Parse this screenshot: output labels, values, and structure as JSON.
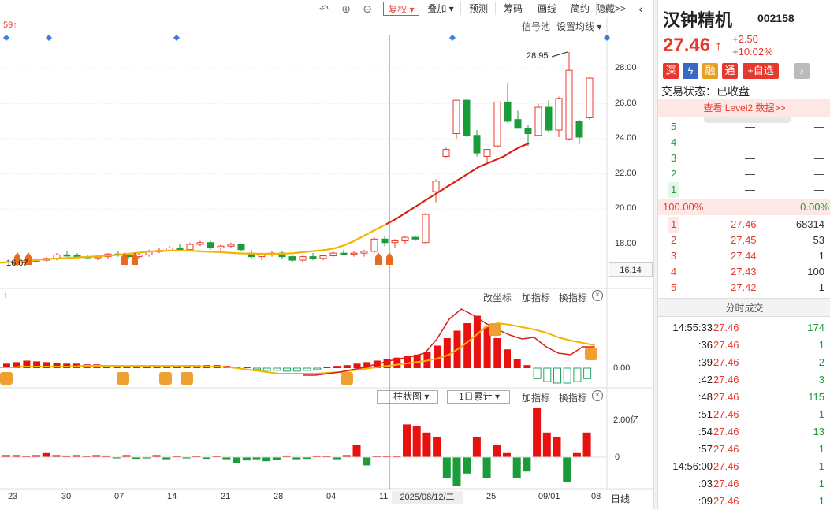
{
  "toolbar": {
    "undo_icon": "undo-icon",
    "zoom_in_icon": "zoom-in-icon",
    "zoom_out_icon": "zoom-out-icon",
    "fuquan": "复权",
    "diejia": "叠加",
    "yuce": "预测",
    "choumu": "筹码",
    "huaxian": "画线",
    "jiancao": "简约",
    "yincang": "隐藏>>"
  },
  "main_chart": {
    "top_left_label": "59",
    "signal_pool": "信号池",
    "ma_setting": "设置均线",
    "peak_label": "28.95",
    "low_label": "16.67",
    "y_ticks": [
      "28.00",
      "26.00",
      "24.00",
      "22.00",
      "20.00",
      "18.00"
    ],
    "price_box": "16.14"
  },
  "indicator_panel": {
    "gai_zuobiao": "改坐标",
    "jia_zhibiao": "加指标",
    "huan_zhibiao": "换指标",
    "zero_label": "0.00"
  },
  "volume_panel": {
    "chart_type": "柱状图",
    "accumulate": "1日累计",
    "jia_zhibiao": "加指标",
    "huan_zhibiao": "换指标",
    "y_top": "2.00亿",
    "y_zero": "0"
  },
  "x_axis": {
    "labels": [
      "23",
      "30",
      "07",
      "14",
      "21",
      "28",
      "04",
      "11",
      "25",
      "09/01",
      "08"
    ],
    "cursor_date": "2025/08/12/二",
    "period": "日线"
  },
  "chart_data": {
    "type": "candlestick",
    "candles": [
      [
        16.9,
        17.0,
        16.8,
        16.95
      ],
      [
        16.95,
        17.1,
        16.9,
        17.05
      ],
      [
        17.05,
        17.2,
        17.0,
        17.1
      ],
      [
        17.1,
        17.3,
        17.0,
        17.2
      ],
      [
        17.2,
        17.5,
        17.1,
        17.4
      ],
      [
        17.4,
        17.6,
        17.3,
        17.35
      ],
      [
        17.35,
        17.5,
        17.2,
        17.3
      ],
      [
        17.3,
        17.4,
        17.2,
        17.25
      ],
      [
        17.25,
        17.4,
        17.1,
        17.3
      ],
      [
        17.3,
        17.5,
        17.2,
        17.45
      ],
      [
        17.45,
        17.6,
        17.3,
        17.4
      ],
      [
        17.4,
        17.5,
        17.2,
        17.3
      ],
      [
        17.3,
        17.5,
        17.2,
        17.4
      ],
      [
        17.4,
        17.7,
        17.3,
        17.6
      ],
      [
        17.6,
        17.8,
        17.5,
        17.65
      ],
      [
        17.65,
        17.9,
        17.6,
        17.8
      ],
      [
        17.8,
        18.0,
        17.6,
        17.7
      ],
      [
        17.7,
        18.1,
        17.6,
        18.0
      ],
      [
        18.0,
        18.2,
        17.9,
        18.1
      ],
      [
        18.1,
        18.2,
        17.7,
        17.8
      ],
      [
        17.8,
        18.0,
        17.6,
        17.9
      ],
      [
        17.9,
        18.1,
        17.8,
        18.0
      ],
      [
        18.0,
        18.0,
        17.6,
        17.7
      ],
      [
        17.5,
        17.7,
        17.2,
        17.3
      ],
      [
        17.3,
        17.5,
        17.1,
        17.4
      ],
      [
        17.4,
        17.6,
        17.3,
        17.5
      ],
      [
        17.5,
        17.6,
        17.2,
        17.3
      ],
      [
        17.3,
        17.4,
        17.0,
        17.1
      ],
      [
        17.1,
        17.4,
        17.0,
        17.3
      ],
      [
        17.3,
        17.5,
        17.1,
        17.2
      ],
      [
        17.2,
        17.4,
        17.1,
        17.35
      ],
      [
        17.35,
        17.6,
        17.3,
        17.5
      ],
      [
        17.5,
        17.7,
        17.4,
        17.45
      ],
      [
        17.45,
        17.6,
        17.3,
        17.5
      ],
      [
        17.5,
        17.7,
        17.3,
        17.6
      ],
      [
        17.6,
        18.4,
        17.5,
        18.3
      ],
      [
        18.3,
        18.5,
        17.9,
        18.1
      ],
      [
        18.1,
        18.3,
        17.8,
        18.2
      ],
      [
        18.2,
        18.5,
        18.0,
        18.4
      ],
      [
        18.4,
        18.5,
        18.2,
        18.3
      ],
      [
        18.1,
        19.8,
        18.0,
        19.7
      ],
      [
        21.0,
        21.7,
        20.4,
        21.6
      ],
      [
        23.0,
        23.5,
        22.9,
        23.4
      ],
      [
        24.3,
        26.2,
        24.0,
        26.2
      ],
      [
        26.2,
        26.3,
        24.1,
        24.2
      ],
      [
        24.2,
        24.5,
        23.0,
        23.2
      ],
      [
        23.0,
        23.4,
        22.6,
        23.4
      ],
      [
        23.6,
        26.1,
        23.5,
        26.1
      ],
      [
        26.1,
        27.2,
        24.9,
        25.0
      ],
      [
        25.1,
        25.6,
        24.6,
        24.6
      ],
      [
        24.6,
        24.8,
        23.6,
        24.3
      ],
      [
        24.2,
        26.0,
        24.2,
        25.8
      ],
      [
        25.8,
        26.2,
        24.4,
        24.5
      ],
      [
        24.5,
        26.4,
        24.1,
        26.3
      ],
      [
        24.0,
        28.95,
        23.9,
        27.9
      ],
      [
        25.0,
        25.1,
        23.7,
        24.1
      ],
      [
        25.2,
        27.5,
        25.1,
        27.46
      ]
    ],
    "ma_line": [
      16.95,
      17.0,
      17.02,
      17.05,
      17.1,
      17.14,
      17.17,
      17.2,
      17.22,
      17.25,
      17.28,
      17.3,
      17.33,
      17.36,
      17.4,
      17.45,
      17.5,
      17.55,
      17.6,
      17.62,
      17.64,
      17.65,
      17.65,
      17.63,
      17.6,
      17.58,
      17.56,
      17.53,
      17.5,
      17.48,
      17.47,
      17.46,
      17.46,
      17.46,
      17.47,
      17.5,
      17.55,
      17.6,
      17.65,
      17.7,
      17.8,
      17.95,
      18.15,
      18.4,
      18.65,
      18.9,
      19.15,
      19.4,
      19.7,
      20.0,
      20.3,
      20.6,
      20.9,
      21.2,
      21.5,
      21.8,
      22.1,
      22.4,
      22.6,
      22.8,
      23.0,
      23.3,
      23.55,
      23.75
    ],
    "volume": [
      0.05,
      0.05,
      0.03,
      0.05,
      0.1,
      0.05,
      0.04,
      0.05,
      0.03,
      0.05,
      0.04,
      -0.03,
      0.05,
      -0.04,
      -0.03,
      0.05,
      -0.05,
      0.03,
      -0.03,
      0.02,
      -0.04,
      0.03,
      -0.05,
      -0.15,
      -0.08,
      -0.05,
      -0.1,
      -0.06,
      0.04,
      -0.05,
      -0.04,
      0.03,
      0.03,
      -0.05,
      0.05,
      0.3,
      -0.2,
      0.03,
      0.02,
      0.02,
      0.8,
      0.75,
      0.6,
      0.5,
      -0.5,
      -0.7,
      -0.4,
      0.5,
      -0.5,
      0.3,
      0.1,
      -0.5,
      -0.35,
      1.2,
      0.6,
      0.5,
      -0.6,
      0.1,
      0.6
    ],
    "ylim": [
      15.5,
      29.5
    ]
  },
  "quote": {
    "name": "汉钟精机",
    "code": "002158",
    "price": "27.46",
    "change": "+2.50",
    "change_pct": "+10.02%",
    "badges": [
      "深",
      "融",
      "通"
    ],
    "add_fav": "+自选",
    "bell_icon": "bell-icon",
    "lightning_icon": "lightning-icon",
    "status_label": "交易状态：",
    "status_value": "已收盘",
    "level2": "查看 Level2 数据>>",
    "sell_levels": [
      {
        "level": "5",
        "price": "—",
        "vol": "—"
      },
      {
        "level": "4",
        "price": "—",
        "vol": "—"
      },
      {
        "level": "3",
        "price": "—",
        "vol": "—"
      },
      {
        "level": "2",
        "price": "—",
        "vol": "—"
      },
      {
        "level": "1",
        "price": "—",
        "vol": "—"
      }
    ],
    "buy_ratio": "100.00%",
    "sell_ratio": "0.00%",
    "buy_levels": [
      {
        "level": "1",
        "price": "27.46",
        "vol": "68314"
      },
      {
        "level": "2",
        "price": "27.45",
        "vol": "53"
      },
      {
        "level": "3",
        "price": "27.44",
        "vol": "1"
      },
      {
        "level": "4",
        "price": "27.43",
        "vol": "100"
      },
      {
        "level": "5",
        "price": "27.42",
        "vol": "1"
      }
    ],
    "ticks_title": "分时成交",
    "ticks": [
      {
        "time": "14:55:33",
        "price": "27.46",
        "vol": "174"
      },
      {
        "time": ":36",
        "price": "27.46",
        "vol": "1"
      },
      {
        "time": ":39",
        "price": "27.46",
        "vol": "2"
      },
      {
        "time": ":42",
        "price": "27.46",
        "vol": "3"
      },
      {
        "time": ":48",
        "price": "27.46",
        "vol": "115"
      },
      {
        "time": ":51",
        "price": "27.46",
        "vol": "1"
      },
      {
        "time": ":54",
        "price": "27.46",
        "vol": "13"
      },
      {
        "time": ":57",
        "price": "27.46",
        "vol": "1"
      },
      {
        "time": "14:56:00",
        "price": "27.46",
        "vol": "1"
      },
      {
        "time": ":03",
        "price": "27.46",
        "vol": "1"
      },
      {
        "time": ":09",
        "price": "27.46",
        "vol": "1"
      }
    ]
  }
}
